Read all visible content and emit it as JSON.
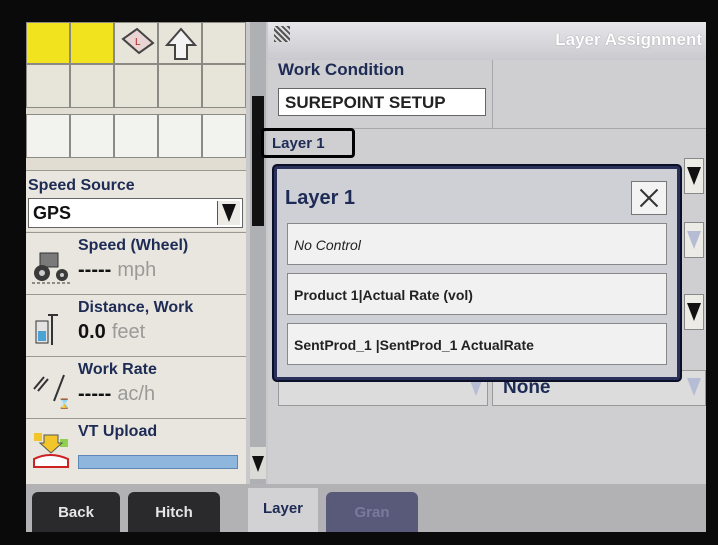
{
  "header": {
    "title": "Layer Assignment"
  },
  "work_condition": {
    "label": "Work Condition",
    "value": "SUREPOINT SETUP"
  },
  "layer_label": "Layer 1",
  "speed_source": {
    "label": "Speed Source",
    "value": "GPS"
  },
  "stats": [
    {
      "title": "Speed (Wheel)",
      "value": "-----",
      "unit": "mph"
    },
    {
      "title": "Distance, Work",
      "value": "0.0",
      "unit": "feet"
    },
    {
      "title": "Work Rate",
      "value": "-----",
      "unit": "ac/h"
    },
    {
      "title": "VT Upload"
    }
  ],
  "right_none": "None",
  "modal": {
    "title": "Layer 1",
    "options": [
      "No Control",
      "Product 1|Actual Rate (vol)",
      "SentProd_1 |SentProd_1 ActualRate"
    ]
  },
  "tabs": {
    "back": "Back",
    "hitch": "Hitch",
    "layer": "Layer",
    "gran": "Gran"
  },
  "colors": {
    "accent_yellow": "#f2e31f",
    "label_navy": "#1d2b55",
    "modal_border": "#29305a"
  }
}
